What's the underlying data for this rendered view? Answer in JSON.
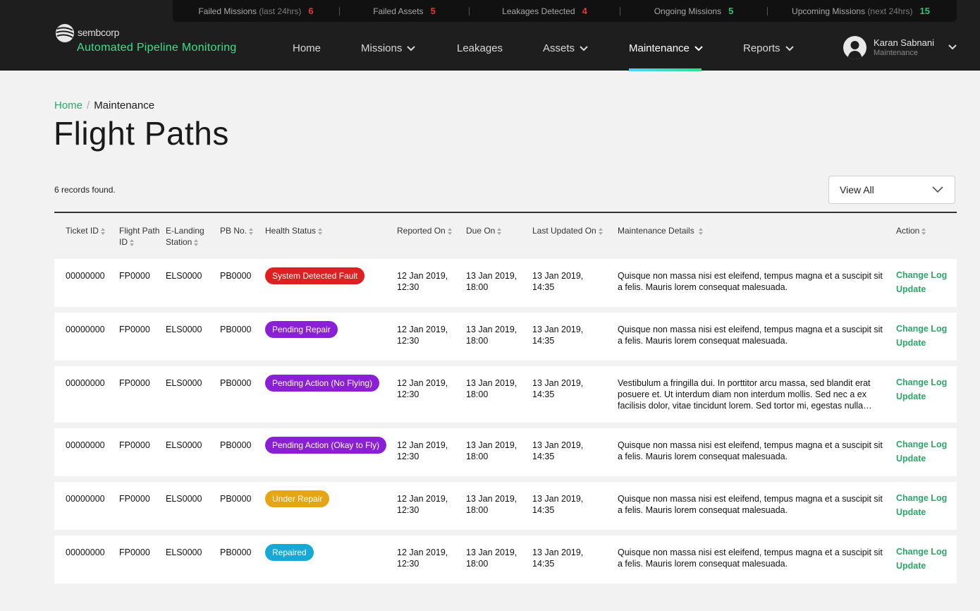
{
  "stats": [
    {
      "label": "Failed Missions",
      "sub": "(last 24hrs)",
      "value": "6",
      "tone": "red"
    },
    {
      "label": "Failed Assets",
      "sub": "",
      "value": "5",
      "tone": "red"
    },
    {
      "label": "Leakages Detected",
      "sub": "",
      "value": "4",
      "tone": "red"
    },
    {
      "label": "Ongoing Missions",
      "sub": "",
      "value": "5",
      "tone": "green"
    },
    {
      "label": "Upcoming Missions",
      "sub": "(next 24hrs)",
      "value": "15",
      "tone": "green"
    }
  ],
  "brand": {
    "logo_text": "sembcorp",
    "app_title": "Automated Pipeline Monitoring"
  },
  "nav": [
    {
      "label": "Home",
      "dropdown": false
    },
    {
      "label": "Missions",
      "dropdown": true
    },
    {
      "label": "Leakages",
      "dropdown": false
    },
    {
      "label": "Assets",
      "dropdown": true
    },
    {
      "label": "Maintenance",
      "dropdown": true,
      "active": true
    },
    {
      "label": "Reports",
      "dropdown": true
    }
  ],
  "user": {
    "name": "Karan Sabnani",
    "role": "Maintenance"
  },
  "breadcrumb": {
    "home": "Home",
    "sep": "/",
    "current": "Maintenance"
  },
  "page": {
    "title": "Flight Paths",
    "records": "6 records found.",
    "filter": "View All"
  },
  "columns": [
    {
      "key": "ticket",
      "label": "Ticket ID"
    },
    {
      "key": "flight",
      "label": "Flight Path ID"
    },
    {
      "key": "station",
      "label": "E-Landing Station"
    },
    {
      "key": "pb",
      "label": "PB No."
    },
    {
      "key": "health",
      "label": "Health Status"
    },
    {
      "key": "reported",
      "label": "Reported On"
    },
    {
      "key": "due",
      "label": "Due On"
    },
    {
      "key": "updated",
      "label": "Last Updated On"
    },
    {
      "key": "details",
      "label": "Maintenance Details"
    },
    {
      "key": "action",
      "label": "Action"
    }
  ],
  "actions": {
    "change_log": "Change Log",
    "update": "Update"
  },
  "rows": [
    {
      "ticket": "00000000",
      "flight": "FP0000",
      "station": "ELS0000",
      "pb": "PB0000",
      "health": "System Detected Fault",
      "color": "#e02020",
      "reported": "12 Jan 2019, 12:30",
      "due": "13 Jan 2019, 18:00",
      "updated": "13 Jan 2019, 14:35",
      "details": "Quisque non massa nisi est eleifend, tempus magna et a suscipit sit a felis. Mauris lorem consequat malesuada."
    },
    {
      "ticket": "00000000",
      "flight": "FP0000",
      "station": "ELS0000",
      "pb": "PB0000",
      "health": "Pending Repair",
      "color": "#8a1fd6",
      "reported": "12 Jan 2019, 12:30",
      "due": "13 Jan 2019, 18:00",
      "updated": "13 Jan 2019, 14:35",
      "details": "Quisque non massa nisi est eleifend, tempus magna et a suscipit sit a felis. Mauris lorem consequat malesuada."
    },
    {
      "ticket": "00000000",
      "flight": "FP0000",
      "station": "ELS0000",
      "pb": "PB0000",
      "health": "Pending Action (No Flying)",
      "color": "#8a1fd6",
      "reported": "12 Jan 2019, 12:30",
      "due": "13 Jan 2019, 18:00",
      "updated": "13 Jan 2019, 14:35",
      "details": "Vestibulum a fringilla dui. In porttitor arcu massa, sed blandit erat posuere et. Ut interdum diam non interdum mollis. Sed nec a ex facilisis dolor, vitae tincidunt lorem. Sed tortor mi, egestas nulla…"
    },
    {
      "ticket": "00000000",
      "flight": "FP0000",
      "station": "ELS0000",
      "pb": "PB0000",
      "health": "Pending Action (Okay to Fly)",
      "color": "#8a1fd6",
      "reported": "12 Jan 2019, 12:30",
      "due": "13 Jan 2019, 18:00",
      "updated": "13 Jan 2019, 14:35",
      "details": "Quisque non massa nisi est eleifend, tempus magna et a suscipit sit a felis. Mauris lorem consequat malesuada."
    },
    {
      "ticket": "00000000",
      "flight": "FP0000",
      "station": "ELS0000",
      "pb": "PB0000",
      "health": "Under Repair",
      "color": "#e6a514",
      "reported": "12 Jan 2019, 12:30",
      "due": "13 Jan 2019, 18:00",
      "updated": "13 Jan 2019, 14:35",
      "details": "Quisque non massa nisi est eleifend, tempus magna et a suscipit sit a felis. Mauris lorem consequat malesuada."
    },
    {
      "ticket": "00000000",
      "flight": "FP0000",
      "station": "ELS0000",
      "pb": "PB0000",
      "health": "Repaired",
      "color": "#17a9d6",
      "reported": "12 Jan 2019, 12:30",
      "due": "13 Jan 2019, 18:00",
      "updated": "13 Jan 2019, 14:35",
      "details": "Quisque non massa nisi est eleifend, tempus magna et a suscipit sit a felis. Mauris lorem consequat malesuada."
    }
  ]
}
